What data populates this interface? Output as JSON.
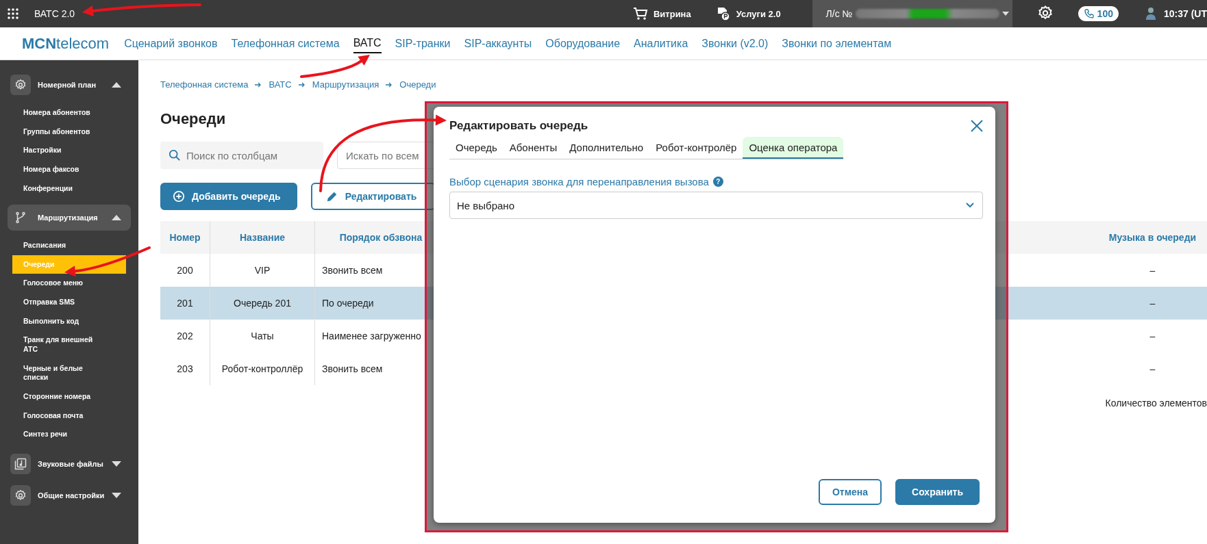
{
  "top_bar": {
    "app_title": "ВАТС 2.0",
    "links": [
      {
        "label": "Витрина"
      },
      {
        "label": "Услуги 2.0"
      }
    ],
    "account_label": "Л/с №",
    "calls_badge": "100",
    "time": "10:37 (UT"
  },
  "nav": {
    "logo": "**MCN**telecom",
    "items": [
      {
        "label": "Сценарий звонков",
        "selected": false
      },
      {
        "label": "Телефонная система",
        "selected": false
      },
      {
        "label": "ВАТС",
        "selected": true
      },
      {
        "label": "SIP-транки",
        "selected": false
      },
      {
        "label": "SIP-аккаунты",
        "selected": false
      },
      {
        "label": "Оборудование",
        "selected": false
      },
      {
        "label": "Аналитика",
        "selected": false
      },
      {
        "label": "Звонки (v2.0)",
        "selected": false
      },
      {
        "label": "Звонки по элементам",
        "selected": false
      }
    ]
  },
  "sidebar": {
    "sections": [
      {
        "title": "Номерной план",
        "expanded": true,
        "selected": false,
        "children": [
          {
            "label": "Номера абонентов",
            "selected": false
          },
          {
            "label": "Группы абонентов",
            "selected": false
          },
          {
            "label": "Настройки",
            "selected": false
          },
          {
            "label": "Номера факсов",
            "selected": false
          },
          {
            "label": "Конференции",
            "selected": false
          }
        ]
      },
      {
        "title": "Маршрутизация",
        "expanded": true,
        "selected": true,
        "children": [
          {
            "label": "Расписания",
            "selected": false
          },
          {
            "label": "Очереди",
            "selected": true
          },
          {
            "label": "Голосовое меню",
            "selected": false
          },
          {
            "label": "Отправка SMS",
            "selected": false
          },
          {
            "label": "Выполнить код",
            "selected": false
          },
          {
            "label": "Транк для внешней АТС",
            "selected": false
          },
          {
            "label": "Черные и белые списки",
            "selected": false
          },
          {
            "label": "Сторонние номера",
            "selected": false
          },
          {
            "label": "Голосовая почта",
            "selected": false
          },
          {
            "label": "Синтез речи",
            "selected": false
          }
        ]
      },
      {
        "title": "Звуковые файлы",
        "expanded": false,
        "selected": false
      },
      {
        "title": "Общие настройки",
        "expanded": false,
        "selected": false
      }
    ]
  },
  "breadcrumb": [
    "Телефонная система",
    "ВАТС",
    "Маршрутизация",
    "Очереди"
  ],
  "page_title": "Очереди",
  "search": {
    "placeholder": "Поиск по столбцам"
  },
  "global_search": {
    "placeholder": "Искать по всем"
  },
  "buttons": [
    {
      "label": "Добавить очередь",
      "kind": "primary"
    },
    {
      "label": "Редактировать",
      "kind": "outline"
    }
  ],
  "table": {
    "columns": [
      "Номер",
      "Название",
      "Порядок обзвона",
      "Музыка в очереди"
    ],
    "rows": [
      {
        "cells": [
          "200",
          "VIP",
          "Звонить всем",
          "–"
        ],
        "selected": false
      },
      {
        "cells": [
          "201",
          "Очередь 201",
          "По очереди",
          "–"
        ],
        "selected": true
      },
      {
        "cells": [
          "202",
          "Чаты",
          "Наименее загруженно",
          "–"
        ],
        "selected": false
      },
      {
        "cells": [
          "203",
          "Робот-контроллёр",
          "Звонить всем",
          "–"
        ],
        "selected": false
      }
    ]
  },
  "footer": "Количество элементов",
  "dialog": {
    "title": "Редактировать очередь",
    "tabs": [
      {
        "label": "Очередь",
        "selected": false
      },
      {
        "label": "Абоненты",
        "selected": false
      },
      {
        "label": "Дополнительно",
        "selected": false
      },
      {
        "label": "Робот-контролёр",
        "selected": false
      },
      {
        "label": "Оценка оператора",
        "selected": true
      }
    ],
    "field": {
      "label": "Выбор сценария звонка для перенаправления вызова",
      "help_mark": "?",
      "value": "Не выбрано"
    },
    "buttons": [
      {
        "label": "Отмена",
        "kind": "outline"
      },
      {
        "label": "Сохранить",
        "kind": "primary"
      }
    ]
  }
}
